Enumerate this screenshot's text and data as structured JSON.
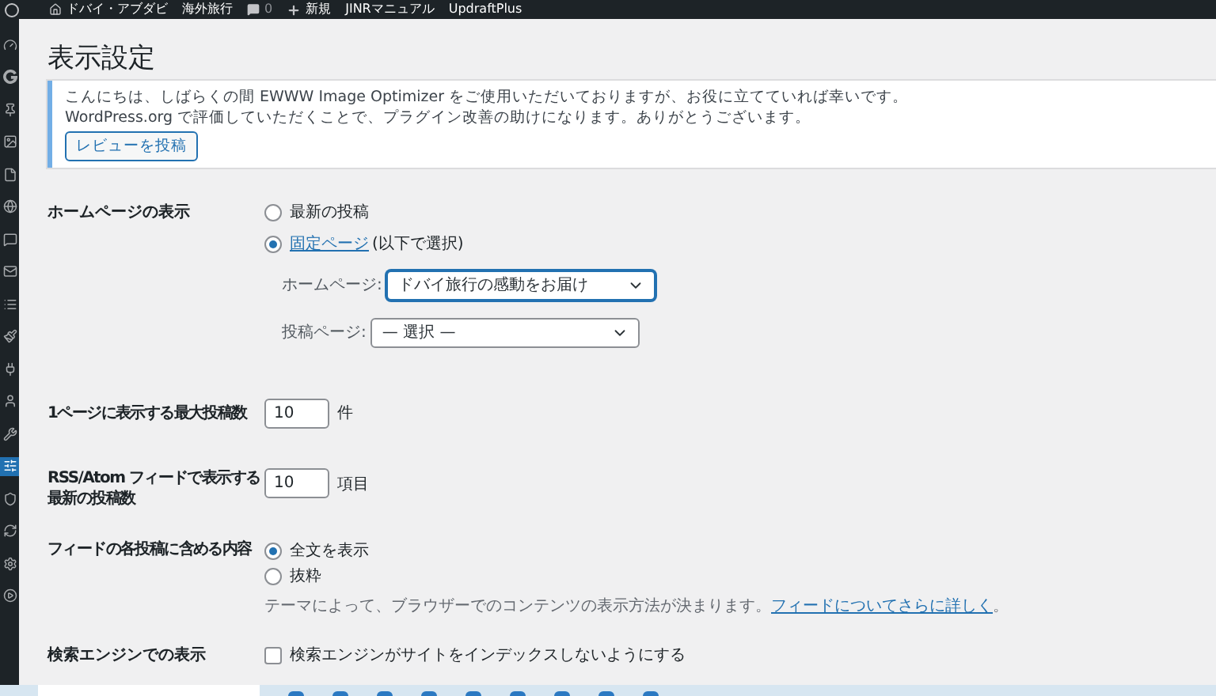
{
  "admin_bar": {
    "site_name": "ドバイ・アブダビ",
    "items": [
      {
        "kind": "text",
        "label": "海外旅行"
      },
      {
        "kind": "comments",
        "label": "0"
      },
      {
        "kind": "new",
        "label": "新規"
      },
      {
        "kind": "text",
        "label": "JINRマニュアル"
      },
      {
        "kind": "text",
        "label": "UpdraftPlus"
      }
    ]
  },
  "sidebar": {
    "items": [
      {
        "kind": "dashboard",
        "selected": false
      },
      {
        "kind": "g",
        "selected": false
      },
      {
        "kind": "pin",
        "selected": false
      },
      {
        "kind": "media",
        "selected": false
      },
      {
        "kind": "page",
        "selected": false
      },
      {
        "kind": "swirl",
        "selected": false
      },
      {
        "kind": "comment",
        "selected": false
      },
      {
        "kind": "mail",
        "selected": false
      },
      {
        "kind": "list",
        "selected": false
      },
      {
        "kind": "brush",
        "selected": false
      },
      {
        "kind": "plug",
        "selected": false
      },
      {
        "kind": "user",
        "selected": false
      },
      {
        "kind": "wrench",
        "selected": false
      },
      {
        "kind": "settings-panel",
        "selected": true
      },
      {
        "kind": "shield",
        "selected": false
      },
      {
        "kind": "refresh",
        "selected": false
      },
      {
        "kind": "gear",
        "selected": false
      },
      {
        "kind": "play",
        "selected": false
      }
    ]
  },
  "page_title": "表示設定",
  "notice": {
    "lines": [
      "こんにちは、しばらくの間 EWWW Image Optimizer をご使用いただいておりますが、お役に立てていれば幸いです。",
      "WordPress.org で評価していただくことで、プラグイン改善の助けになります。ありがとうございます。"
    ],
    "button": "レビューを投稿"
  },
  "homepage_display": {
    "label": "ホームページの表示",
    "options": [
      {
        "label": "最新の投稿",
        "selected": false
      },
      {
        "link": "固定ページ",
        "suffix": "(以下で選択)",
        "selected": true
      }
    ],
    "homepage_select": {
      "label": "ホームページ:",
      "value": "ドバイ旅行の感動をお届け",
      "focused": true
    },
    "posts_select": {
      "label": "投稿ページ:",
      "value": "— 選択 —",
      "focused": false
    }
  },
  "posts_per_page": {
    "label": "1ページに表示する最大投稿数",
    "value": "10",
    "unit": "件"
  },
  "rss_posts": {
    "label_lines": [
      "RSS/Atom フィードで表示する",
      "最新の投稿数"
    ],
    "value": "10",
    "unit": "項目"
  },
  "feed_content": {
    "label": "フィードの各投稿に含める内容",
    "options": [
      {
        "label": "全文を表示",
        "selected": true
      },
      {
        "label": "抜粋",
        "selected": false
      }
    ],
    "description": "テーマによって、ブラウザーでのコンテンツの表示方法が決まります。",
    "link": "フィードについてさらに詳しく",
    "after_link": "。"
  },
  "search_engine": {
    "label": "検索エンジンでの表示",
    "checkbox": {
      "label": "検索エンジンがサイトをインデックスしないようにする",
      "checked": false
    }
  }
}
